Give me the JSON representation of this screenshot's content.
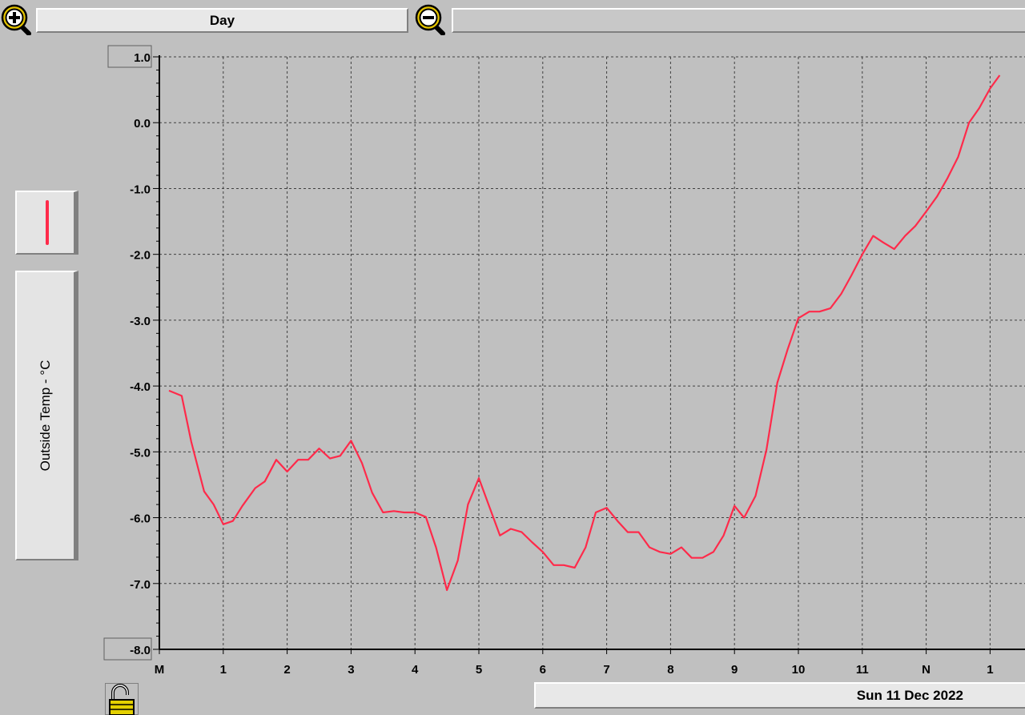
{
  "toolbar": {
    "zoom_in_icon": "zoom-in-magnifier-icon",
    "zoom_out_icon": "zoom-out-magnifier-icon",
    "range_label": "Day"
  },
  "legend": {
    "series_color": "#ff2a4a",
    "ylabel": "Outside Temp - °C"
  },
  "footer": {
    "date_label": "Sun 11 Dec 2022",
    "lock_icon": "padlock-icon"
  },
  "colors": {
    "background": "#c0c0c0",
    "line": "#ff2a4a",
    "grid": "#404040"
  },
  "chart_data": {
    "type": "line",
    "title": "",
    "xlabel": "",
    "ylabel": "Outside Temp - °C",
    "ylim": [
      -8.0,
      1.0
    ],
    "xlim": [
      0,
      13.45
    ],
    "grid": true,
    "y_ticks": [
      "1.0",
      "0.0",
      "-1.0",
      "-2.0",
      "-3.0",
      "-4.0",
      "-5.0",
      "-6.0",
      "-7.0",
      "-8.0"
    ],
    "x_ticks": [
      "M",
      "1",
      "2",
      "3",
      "4",
      "5",
      "6",
      "7",
      "8",
      "9",
      "10",
      "11",
      "N",
      "1"
    ],
    "series": [
      {
        "color": "#ff2a4a",
        "x": [
          0.15,
          0.35,
          0.5,
          0.7,
          0.85,
          1.0,
          1.15,
          1.3,
          1.5,
          1.65,
          1.83,
          2.0,
          2.17,
          2.33,
          2.5,
          2.67,
          2.83,
          3.0,
          3.17,
          3.33,
          3.5,
          3.67,
          3.83,
          4.0,
          4.17,
          4.33,
          4.5,
          4.67,
          4.83,
          5.0,
          5.17,
          5.33,
          5.5,
          5.67,
          5.83,
          6.0,
          6.17,
          6.33,
          6.5,
          6.67,
          6.83,
          7.0,
          7.17,
          7.33,
          7.5,
          7.67,
          7.83,
          8.0,
          8.17,
          8.33,
          8.5,
          8.67,
          8.83,
          9.0,
          9.15,
          9.33,
          9.5,
          9.67,
          9.83,
          10.0,
          10.17,
          10.33,
          10.5,
          10.67,
          10.83,
          11.0,
          11.17,
          11.33,
          11.5,
          11.67,
          11.83,
          12.0,
          12.17,
          12.33,
          12.5,
          12.67,
          12.83,
          13.0,
          13.15
        ],
        "y": [
          -4.07,
          -4.15,
          -4.85,
          -5.6,
          -5.8,
          -6.1,
          -6.05,
          -5.82,
          -5.55,
          -5.45,
          -5.12,
          -5.3,
          -5.12,
          -5.12,
          -4.95,
          -5.1,
          -5.06,
          -4.83,
          -5.17,
          -5.62,
          -5.92,
          -5.9,
          -5.92,
          -5.92,
          -5.99,
          -6.45,
          -7.1,
          -6.65,
          -5.8,
          -5.4,
          -5.85,
          -6.27,
          -6.17,
          -6.22,
          -6.37,
          -6.52,
          -6.72,
          -6.72,
          -6.76,
          -6.45,
          -5.92,
          -5.85,
          -6.05,
          -6.22,
          -6.22,
          -6.45,
          -6.52,
          -6.55,
          -6.45,
          -6.61,
          -6.61,
          -6.52,
          -6.27,
          -5.82,
          -6.0,
          -5.67,
          -4.97,
          -3.95,
          -3.45,
          -2.97,
          -2.87,
          -2.87,
          -2.82,
          -2.6,
          -2.32,
          -2.0,
          -1.72,
          -1.82,
          -1.92,
          -1.72,
          -1.57,
          -1.35,
          -1.12,
          -0.85,
          -0.52,
          0.0,
          0.22,
          0.52,
          0.72
        ]
      }
    ]
  }
}
